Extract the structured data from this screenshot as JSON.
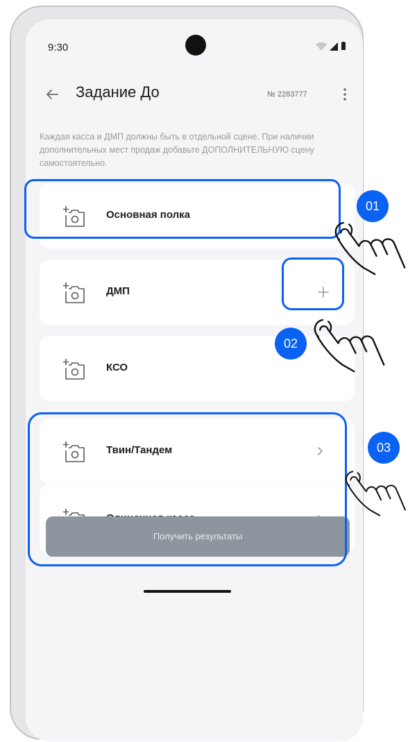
{
  "status_bar": {
    "time": "9:30"
  },
  "header": {
    "title": "Задание До",
    "task_number": "№ 2283777"
  },
  "hint": "Каждая касса и ДМП должны быть в отдельной сцене. При наличии дополнительных мест продаж добавьте ДОПОЛНИТЕЛЬНУЮ сцену самостоятельно.",
  "scenes": [
    {
      "label": "Основная полка",
      "icon": "add-photo-icon"
    },
    {
      "label": "ДМП",
      "icon": "add-photo-icon",
      "action": "plus-icon"
    },
    {
      "label": "КСО",
      "icon": "add-photo-icon"
    },
    {
      "label": "Твин/Тандем",
      "icon": "add-photo-icon",
      "action": "chevron-right-icon"
    },
    {
      "label": "Одиночная касса",
      "icon": "add-photo-icon",
      "action": "chevron-right-icon"
    }
  ],
  "annotations": {
    "step1": "01",
    "step2": "02",
    "step3": "03"
  },
  "footer": {
    "submit_label": "Получить результаты"
  },
  "colors": {
    "accent": "#0a62f2",
    "background": "#f5f5f7",
    "card": "#ffffff",
    "button_disabled": "#8d969e"
  }
}
